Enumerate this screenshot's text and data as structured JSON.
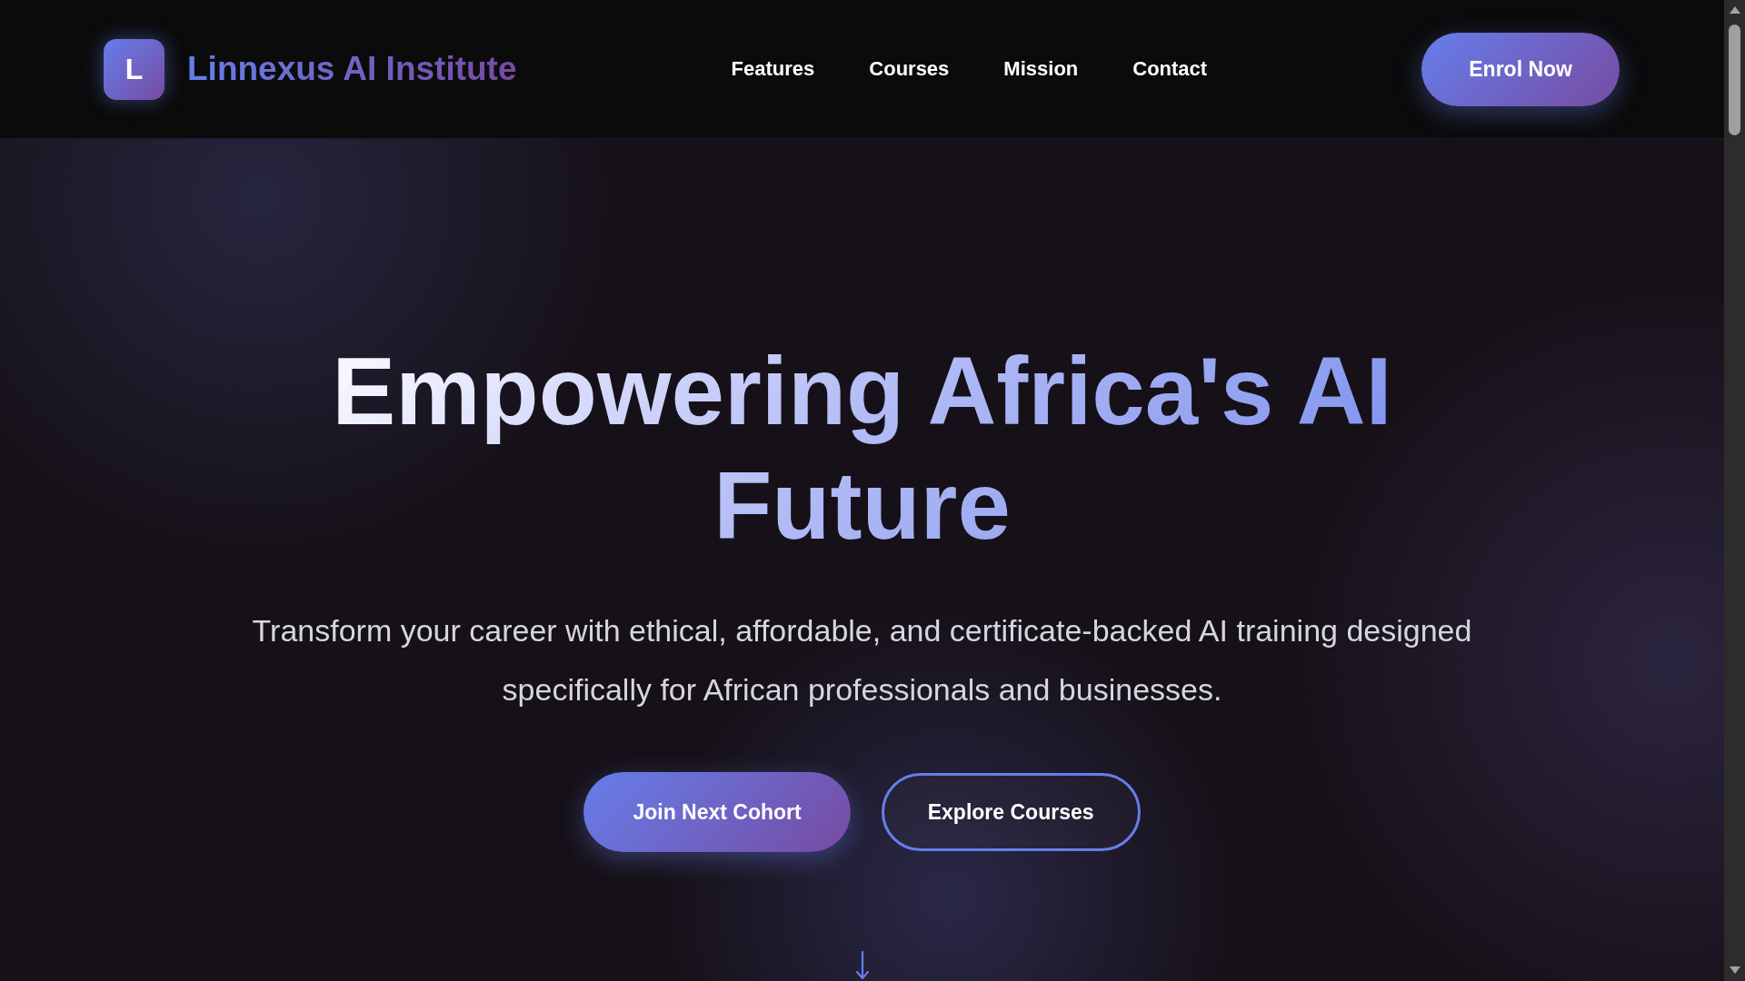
{
  "header": {
    "logo_letter": "L",
    "brand": "Linnexus AI Institute",
    "nav": [
      "Features",
      "Courses",
      "Mission",
      "Contact"
    ],
    "cta": "Enrol Now"
  },
  "hero": {
    "title": "Empowering Africa's AI Future",
    "subtitle": "Transform your career with ethical, affordable, and certificate-backed AI training designed specifically for African professionals and businesses.",
    "buttons": [
      {
        "label": "Join Next Cohort",
        "kind": "primary"
      },
      {
        "label": "Explore Courses",
        "kind": "outline"
      }
    ]
  }
}
